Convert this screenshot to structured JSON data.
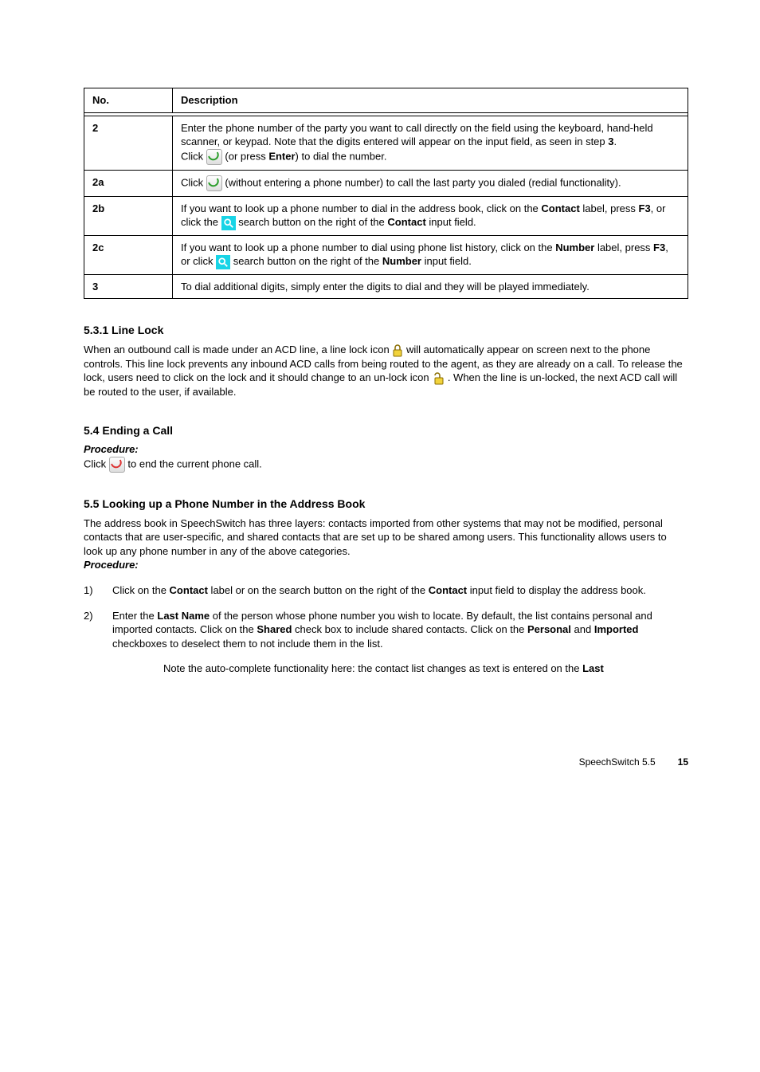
{
  "table": {
    "header": {
      "no": "No.",
      "desc": "Description"
    },
    "rows": [
      {
        "no": "2",
        "lines": [
          "Enter the phone number of the party you want to call directly on the field using the keyboard, hand-held scanner, or keypad.",
          {
            "pre": "Note that the digits entered will appear on the input field, as seen in step "
          },
          {
            "bold": "3"
          },
          {
            "post": "."
          },
          {
            "br": true
          },
          {
            "pre": "Click "
          },
          {
            "icon": "phone-green"
          },
          {
            "post": " (or press "
          },
          {
            "bold": "Enter"
          },
          {
            "post2": ") to dial the number."
          }
        ]
      },
      {
        "no": "2a",
        "lines": [
          "Click ",
          {
            "icon": "phone-green"
          },
          " (without entering a phone number) to call the last party you dialed (redial functionality)."
        ]
      },
      {
        "no": "2b",
        "lines": [
          "If you want to look up a phone number to dial in the address book, click on the ",
          {
            "bold": "Contact"
          },
          " label, press ",
          {
            "bold": "F3"
          },
          ", or click the ",
          {
            "icon": "search"
          },
          " search button on the right of the ",
          {
            "bold": "Contact"
          },
          {
            "post": " input field."
          }
        ]
      },
      {
        "no": "2c",
        "lines": [
          "If you want to look up a phone number to dial using phone list history, click on the ",
          {
            "bold": "Number"
          },
          " label, press ",
          {
            "bold": "F3"
          },
          ", or click ",
          {
            "icon": "search"
          },
          " search button on the right of the ",
          {
            "bold": "Number"
          },
          {
            "post": " input field."
          }
        ]
      },
      {
        "no": "3",
        "lines": [
          "To dial additional digits, simply enter the digits to dial and they will be played immediately."
        ]
      }
    ]
  },
  "sections": {
    "s531": {
      "title": "5.3.1 Line Lock",
      "body_pre": "When an outbound call is made under an ACD line, a line lock icon ",
      "body_mid": " will automatically appear on screen next to the phone controls. This line lock prevents any inbound ACD calls from being routed to the agent, as they are already on a call. To release the lock, users need to click on the lock and it should change to an un-lock icon ",
      "body_post": ". When the line is un-locked, the next ACD call will be routed to the user, if available."
    },
    "s54": {
      "title": "5.4 Ending a Call",
      "subhead": "Procedure:",
      "steps": [
        {
          "pre": "Click ",
          "icon": "phone-red",
          "post": " to end the current phone call."
        }
      ]
    },
    "s55": {
      "title": "5.5 Looking up a Phone Number in the Address Book",
      "body": "The address book in SpeechSwitch has three layers: contacts imported from other systems that may not be modified, personal contacts that are user-specific, and shared contacts that are set up to be shared among users. This functionality allows users to look up any phone number in any of the above categories.",
      "subhead": "Procedure:",
      "steps": [
        {
          "n": "1)",
          "pre": "Click on the ",
          "bold1": "Contact",
          "mid": " label or on the search button on the right of the ",
          "bold2": "Contact",
          "post": " input field to display the address book."
        },
        {
          "n": "2)",
          "pre": "Enter the ",
          "bold1": "Last Name",
          "mid1": " of the person whose phone number you wish to locate. By default, the list contains personal and imported contacts. Click on the ",
          "bold2": "Shared",
          "mid2": " check box to include shared contacts. Click on the ",
          "bold3": "Personal",
          "mid3": " and ",
          "bold4": "Imported",
          "post": " checkboxes to deselect them to not include them in the list."
        }
      ]
    }
  },
  "footnote": {
    "label": "SpeechSwitch 5.5",
    "note_pre": "Note the auto-complete functionality here: the contact list changes as text is entered on the ",
    "note_bold": "Last",
    "page": "15"
  }
}
